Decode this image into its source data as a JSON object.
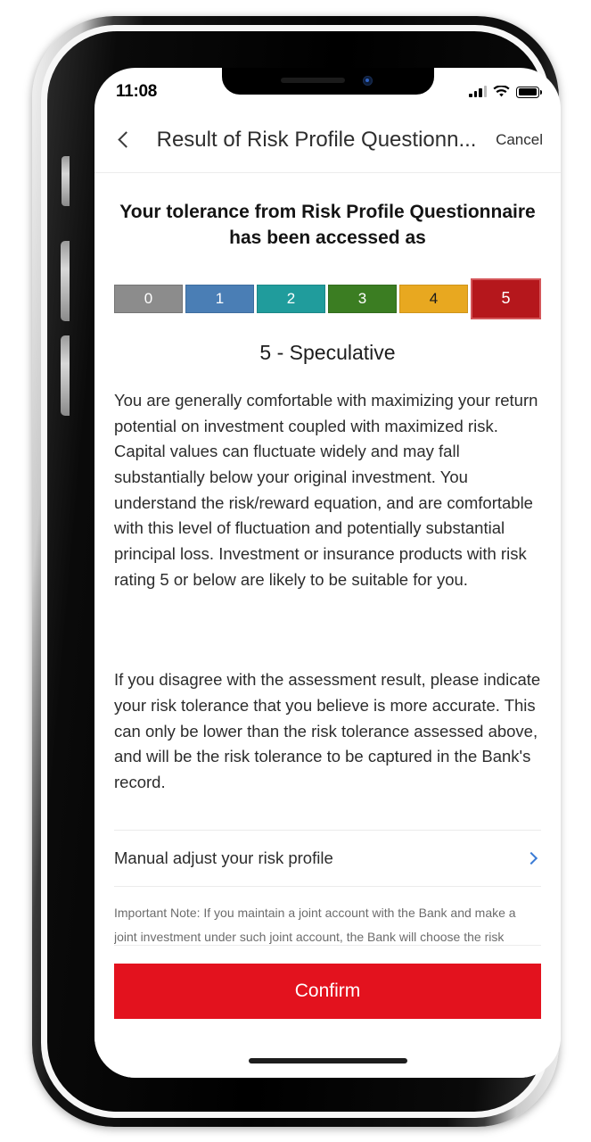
{
  "status_bar": {
    "time": "11:08",
    "signal_icon": "signal-bars-icon",
    "wifi_icon": "wifi-icon",
    "battery_icon": "battery-full-icon"
  },
  "nav_bar": {
    "back_icon": "chevron-left-icon",
    "title": "Result of Risk Profile Questionn...",
    "cancel_label": "Cancel"
  },
  "main": {
    "heading": "Your tolerance from Risk Profile Questionnaire has been accessed as",
    "risk_label": "5 - Speculative",
    "paragraph_description": "You are generally comfortable with maximizing your return potential on investment coupled with maximized risk. Capital values can fluctuate widely and may fall substantially below your original investment. You understand the risk/reward equation, and are comfortable with this level of fluctuation and potentially substantial principal loss. Investment or insurance products with risk rating 5 or below are likely to be suitable for you.",
    "paragraph_disagree": "If you disagree with the assessment result, please indicate your risk tolerance that you believe is more accurate. This can only be lower than the risk tolerance assessed above, and will be the risk tolerance to be captured in the Bank's record.",
    "manual_adjust_label": "Manual adjust your risk profile",
    "manual_adjust_chevron_icon": "chevron-right-icon",
    "important_note": "Important Note: If you maintain a joint account with the Bank and make a joint investment under such joint account, the Bank will choose the risk profile of the one whose risk profile is more conservative between you and"
  },
  "risk_scale": {
    "selected_value": "5",
    "segments": [
      {
        "label": "0",
        "color": "#8C8C8C",
        "border": "#757575",
        "text_color": "#ffffff",
        "selected": false
      },
      {
        "label": "1",
        "color": "#4A7EB5",
        "border": "#3E6D9E",
        "text_color": "#ffffff",
        "selected": false
      },
      {
        "label": "2",
        "color": "#209C9C",
        "border": "#1C8787",
        "text_color": "#ffffff",
        "selected": false
      },
      {
        "label": "3",
        "color": "#3B7D22",
        "border": "#336B1D",
        "text_color": "#ffffff",
        "selected": false
      },
      {
        "label": "4",
        "color": "#E8A820",
        "border": "#CE941B",
        "text_color": "#1a1a1a",
        "selected": false
      },
      {
        "label": "5",
        "color": "#B5171C",
        "border": "#D4565A",
        "text_color": "#ffffff",
        "selected": true
      }
    ]
  },
  "footer": {
    "confirm_label": "Confirm"
  }
}
